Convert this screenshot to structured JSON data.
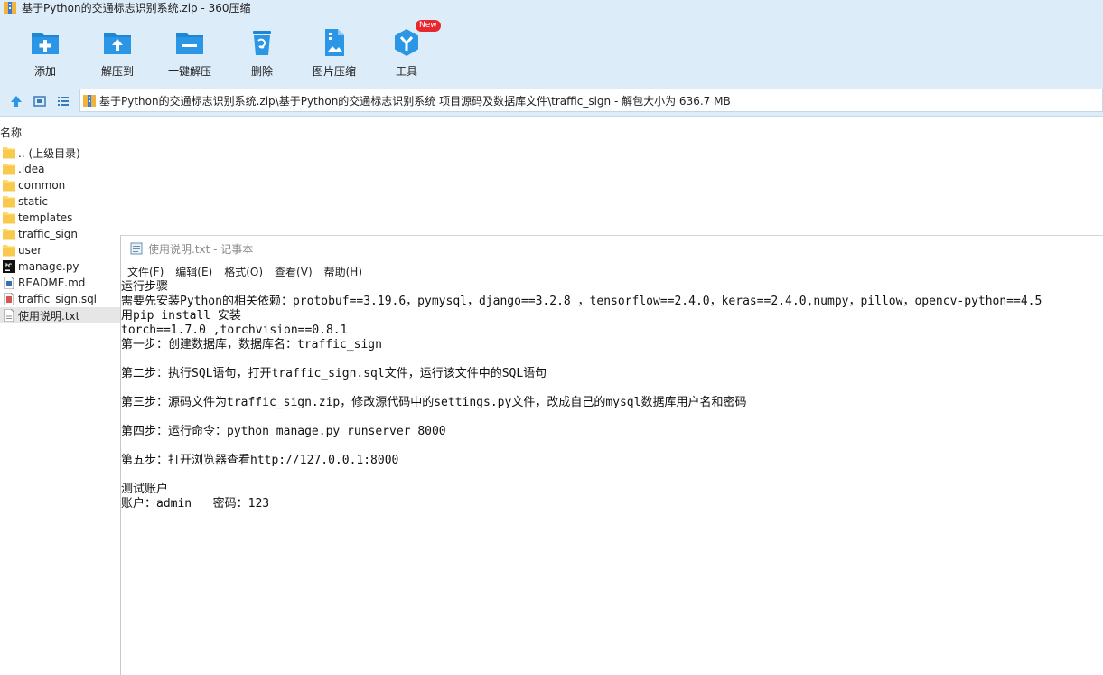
{
  "window": {
    "title": "基于Python的交通标志识别系统.zip - 360压缩"
  },
  "toolbar": {
    "items": [
      {
        "label": "添加",
        "icon": "add-icon"
      },
      {
        "label": "解压到",
        "icon": "extract-to-icon"
      },
      {
        "label": "一键解压",
        "icon": "one-click-extract-icon"
      },
      {
        "label": "删除",
        "icon": "delete-icon"
      },
      {
        "label": "图片压缩",
        "icon": "image-compress-icon"
      },
      {
        "label": "工具",
        "icon": "tools-icon",
        "badge": "New"
      }
    ]
  },
  "address": {
    "path": "基于Python的交通标志识别系统.zip\\基于Python的交通标志识别系统 项目源码及数据库文件\\traffic_sign - 解包大小为 636.7 MB"
  },
  "file_list": {
    "column_header": "名称",
    "items": [
      {
        "name": ".. (上级目录)",
        "type": "folder"
      },
      {
        "name": ".idea",
        "type": "folder"
      },
      {
        "name": "common",
        "type": "folder"
      },
      {
        "name": "static",
        "type": "folder"
      },
      {
        "name": "templates",
        "type": "folder"
      },
      {
        "name": "traffic_sign",
        "type": "folder"
      },
      {
        "name": "user",
        "type": "folder"
      },
      {
        "name": "manage.py",
        "type": "pycharm"
      },
      {
        "name": "README.md",
        "type": "markdown"
      },
      {
        "name": "traffic_sign.sql",
        "type": "sql"
      },
      {
        "name": "使用说明.txt",
        "type": "text"
      }
    ]
  },
  "notepad": {
    "title": "使用说明.txt - 记事本",
    "menu": [
      "文件(F)",
      "编辑(E)",
      "格式(O)",
      "查看(V)",
      "帮助(H)"
    ],
    "lines": [
      "运行步骤",
      "需要先安装Python的相关依赖：protobuf==3.19.6，pymysql，django==3.2.8 ，tensorflow==2.4.0，keras==2.4.0,numpy，pillow，opencv-python==4.5",
      "用pip install 安装",
      "torch==1.7.0 ,torchvision==0.8.1",
      "第一步：创建数据库，数据库名：traffic_sign",
      "",
      "第二步：执行SQL语句，打开traffic_sign.sql文件，运行该文件中的SQL语句",
      "",
      "第三步：源码文件为traffic_sign.zip，修改源代码中的settings.py文件，改成自己的mysql数据库用户名和密码",
      "",
      "第四步：运行命令：python manage.py runserver 8000",
      "",
      "第五步：打开浏览器查看http://127.0.0.1:8000",
      "",
      "测试账户",
      "账户：admin   密码：123"
    ]
  }
}
